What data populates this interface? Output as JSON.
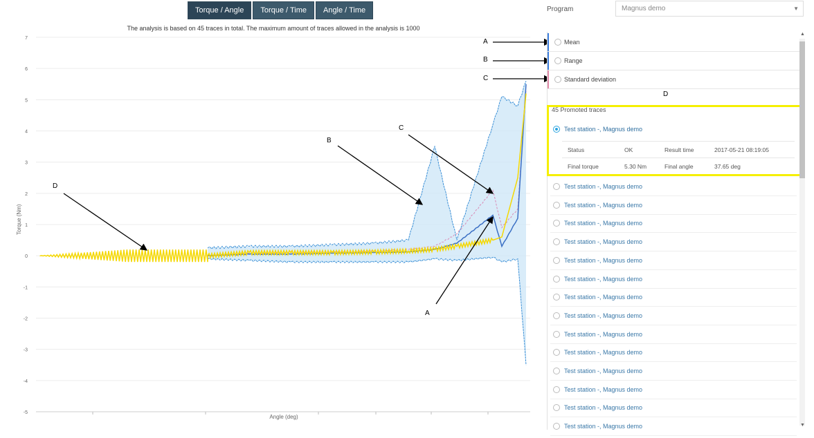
{
  "tabs": [
    {
      "label": "Torque / Angle",
      "active": true
    },
    {
      "label": "Torque / Time",
      "active": false
    },
    {
      "label": "Angle / Time",
      "active": false
    }
  ],
  "caption": "The analysis is based on 45 traces in total. The maximum amount of traces allowed in the analysis is 1000",
  "chart_data": {
    "type": "line",
    "xlabel": "Angle (deg)",
    "ylabel": "Torque (Nm)",
    "ylim": [
      -5,
      7
    ],
    "yticks": [
      "7",
      "6",
      "5",
      "4",
      "3",
      "2",
      "1",
      "0",
      "-1",
      "-2",
      "-3",
      "-4",
      "-5"
    ],
    "series": [
      {
        "role": "mean",
        "values": [
          0,
          0.05,
          0.05,
          0.08,
          0.1,
          0.12,
          0.2,
          0.4,
          1.3,
          0.3,
          1.2,
          5.5
        ]
      },
      {
        "role": "range-upper",
        "values": [
          0.25,
          0.3,
          0.3,
          0.35,
          0.4,
          0.5,
          3.5,
          0.5,
          4.2,
          5.1,
          4.8,
          5.6
        ]
      },
      {
        "role": "range-lower",
        "values": [
          -0.1,
          -0.15,
          -0.2,
          -0.2,
          -0.2,
          -0.2,
          -0.1,
          -0.15,
          -0.05,
          -0.2,
          -0.1,
          -3.5
        ]
      },
      {
        "role": "standard-deviation",
        "values": [
          0,
          0.08,
          0.1,
          0.12,
          0.15,
          0.2,
          0.3,
          0.7,
          2.1,
          0.9,
          1.5,
          5.3
        ]
      },
      {
        "role": "promoted-trace",
        "values": [
          0,
          0.1,
          0.1,
          0.1,
          0.12,
          0.15,
          0.2,
          0.3,
          0.5,
          0.6,
          2.5,
          5.2
        ]
      }
    ],
    "colors": {
      "mean": "#3a6fc4",
      "range": "#3a8fd6",
      "range_fill": "#cfe7f7",
      "std": "#d98ab5",
      "trace": "#f5d800"
    },
    "grid": true
  },
  "program": {
    "label": "Program",
    "value": "Magnus demo"
  },
  "stat_options": [
    {
      "label": "Mean",
      "bar_color": "#3b7ddd"
    },
    {
      "label": "Range",
      "bar_color": "#3b7ddd"
    },
    {
      "label": "Standard deviation",
      "bar_color": "#e08aa8"
    }
  ],
  "traces_header": "45 Promoted traces",
  "selected_trace": {
    "name": "Test station -, Magnus demo",
    "status_label": "Status",
    "status": "OK",
    "result_time_label": "Result time",
    "result_time": "2017-05-21 08:19:05",
    "final_torque_label": "Final torque",
    "final_torque": "5.30 Nm",
    "final_angle_label": "Final angle",
    "final_angle": "37.65 deg"
  },
  "trace_list": [
    "Test station -, Magnus demo",
    "Test station -, Magnus demo",
    "Test station -, Magnus demo",
    "Test station -, Magnus demo",
    "Test station -, Magnus demo",
    "Test station -, Magnus demo",
    "Test station -, Magnus demo",
    "Test station -, Magnus demo",
    "Test station -, Magnus demo",
    "Test station -, Magnus demo",
    "Test station -, Magnus demo",
    "Test station -, Magnus demo",
    "Test station -, Magnus demo",
    "Test station -, Magnus demo"
  ],
  "annotations": {
    "a": "A",
    "b": "B",
    "c": "C",
    "d": "D"
  },
  "icons": {
    "program_caret": "chevron-down-icon",
    "scroll_up": "scroll-up-icon",
    "scroll_down": "scroll-down-icon"
  }
}
